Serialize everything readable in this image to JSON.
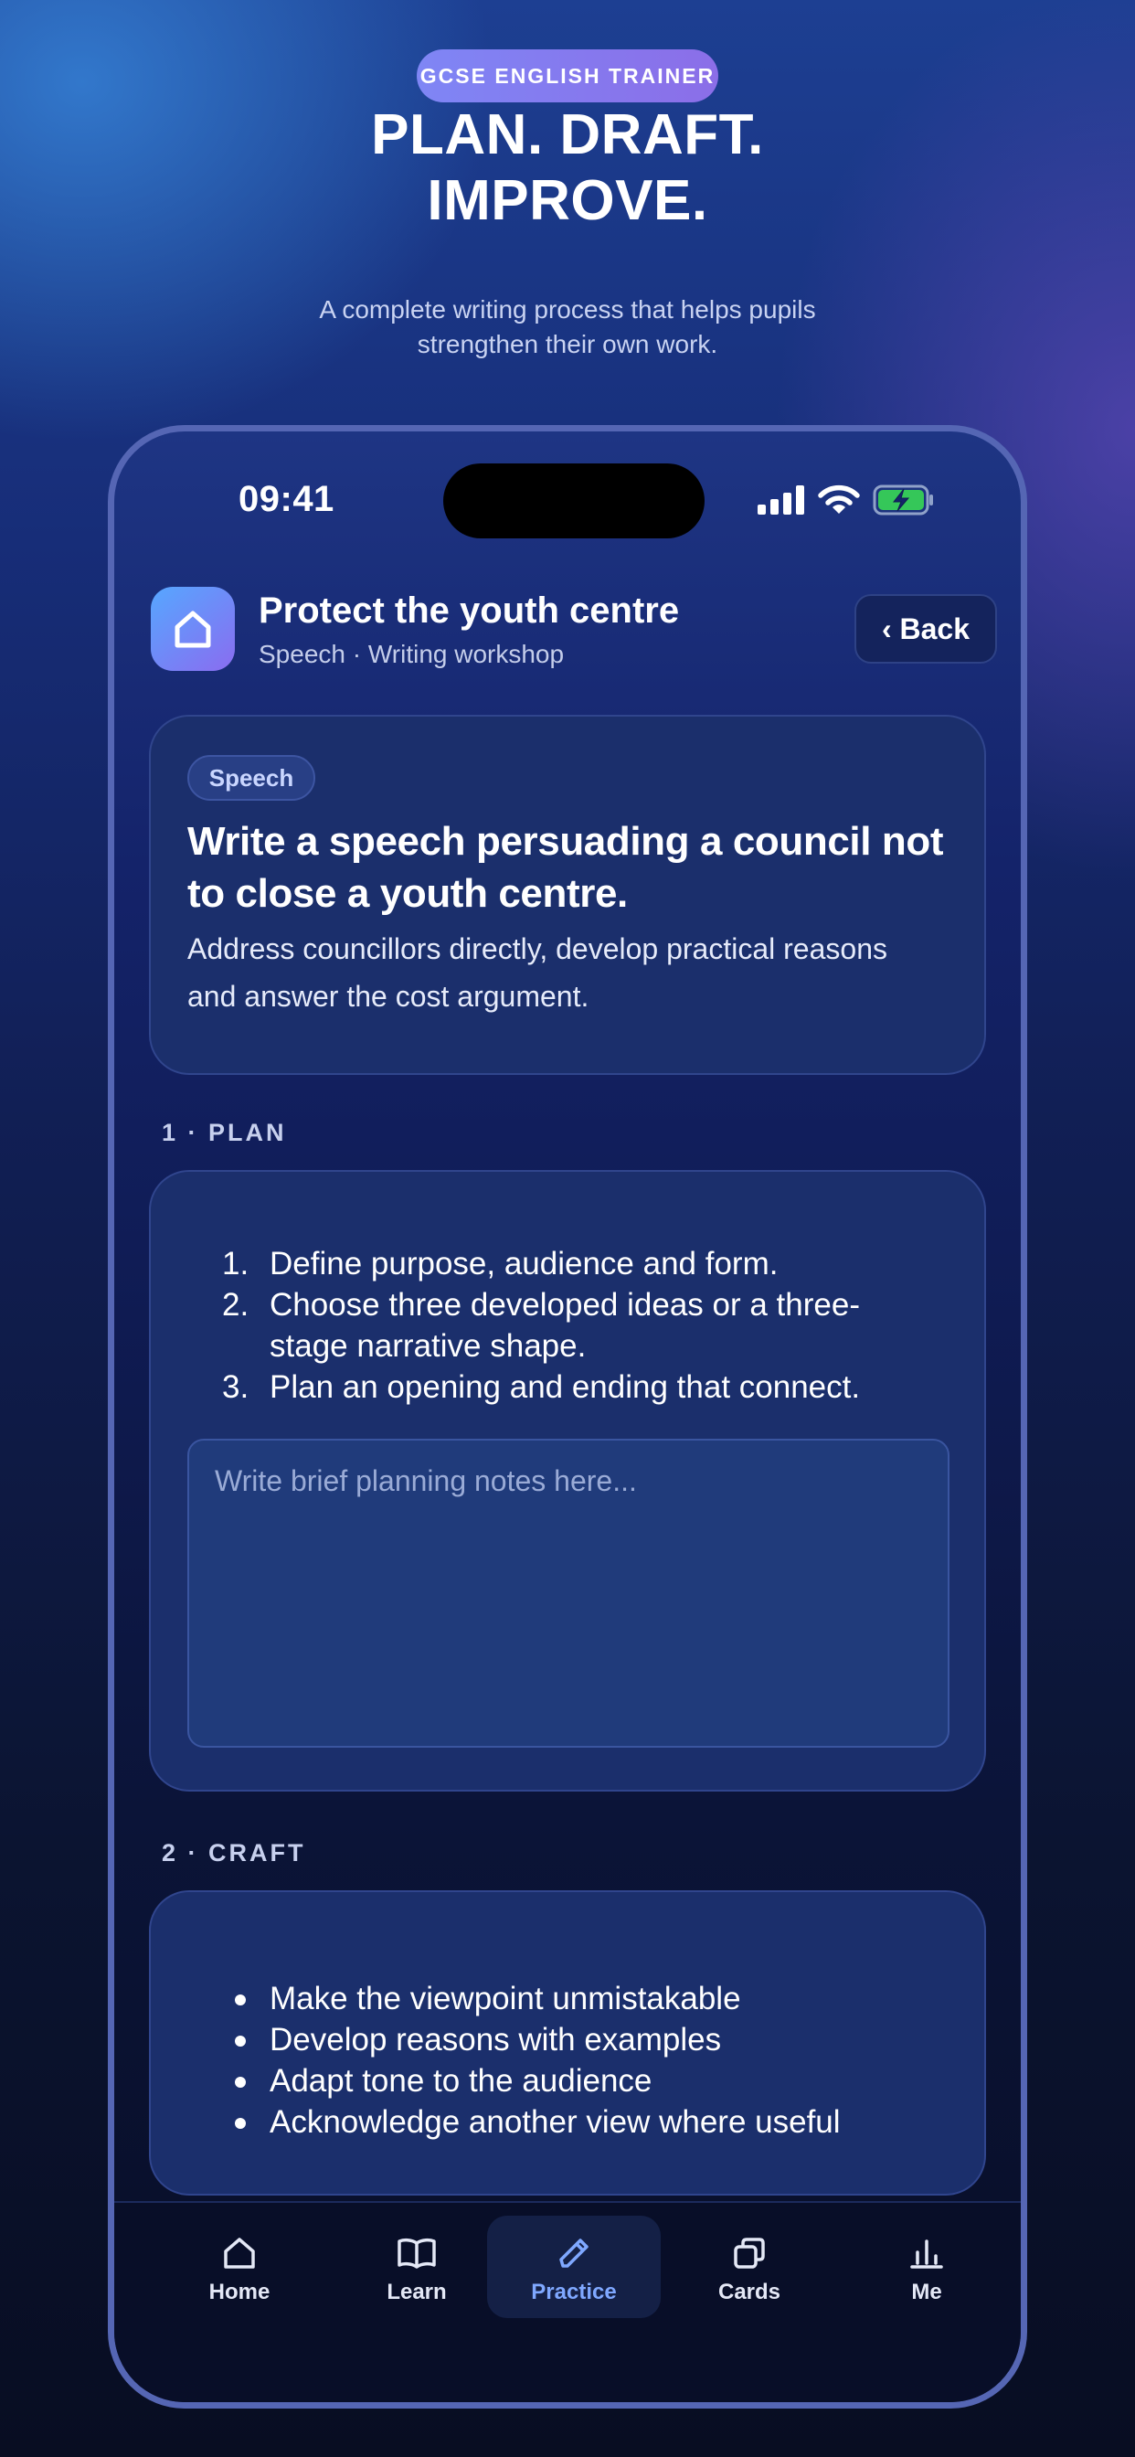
{
  "hero": {
    "badge": "GCSE ENGLISH TRAINER",
    "title_lines": [
      "PLAN. DRAFT.",
      "IMPROVE."
    ],
    "subtitle_lines": [
      "A complete writing process that helps pupils",
      "strengthen their own work."
    ]
  },
  "status_bar": {
    "time": "09:41",
    "icons": [
      "cellular-signal-icon",
      "wifi-icon",
      "battery-charging-icon"
    ]
  },
  "header": {
    "icon": "home-icon",
    "title": "Protect the youth centre",
    "subtitle": "Speech · Writing workshop",
    "back_label": "‹ Back"
  },
  "prompt": {
    "tag": "Speech",
    "title_lines": [
      "Write a speech persuading a council not",
      "to close a youth centre."
    ],
    "description_lines": [
      "Address councillors directly, develop practical reasons",
      "and answer the cost argument."
    ]
  },
  "plan": {
    "label": "1 · PLAN",
    "steps": [
      {
        "num": "1.",
        "lines": [
          "Define purpose, audience and form."
        ]
      },
      {
        "num": "2.",
        "lines": [
          "Choose three developed ideas or a three-",
          "stage narrative shape."
        ]
      },
      {
        "num": "3.",
        "lines": [
          "Plan an opening and ending that connect."
        ]
      }
    ],
    "notes_placeholder": "Write brief planning notes here..."
  },
  "craft": {
    "label": "2 · CRAFT",
    "points": [
      "Make the viewpoint unmistakable",
      "Develop reasons with examples",
      "Adapt tone to the audience",
      "Acknowledge another view where useful"
    ]
  },
  "tabs": [
    {
      "label": "Home",
      "icon": "home-icon",
      "active": false
    },
    {
      "label": "Learn",
      "icon": "book-icon",
      "active": false
    },
    {
      "label": "Practice",
      "icon": "pencil-icon",
      "active": true
    },
    {
      "label": "Cards",
      "icon": "cards-icon",
      "active": false
    },
    {
      "label": "Me",
      "icon": "bar-chart-icon",
      "active": false
    }
  ],
  "colors": {
    "accent": "#7fa8ff",
    "badge_gradient": [
      "#7f86f5",
      "#8b6ee8"
    ],
    "card_bg": "#1b2f6c",
    "battery_green": "#35c759"
  }
}
